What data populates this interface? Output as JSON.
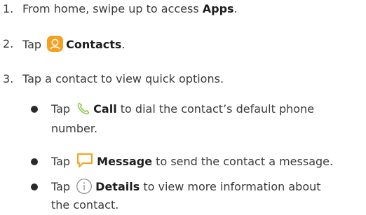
{
  "steps": [
    {
      "num": "1.",
      "before": "From home, swipe up to access ",
      "bold": "Apps",
      "after": "."
    },
    {
      "num": "2.",
      "before": "Tap ",
      "bold": "Contacts",
      "after": "."
    },
    {
      "num": "3.",
      "text": "Tap a contact to view quick options."
    }
  ],
  "bullets": [
    {
      "before": "Tap ",
      "bold": "Call",
      "after": " to dial the contact’s default phone",
      "line2": "number."
    },
    {
      "before": "Tap ",
      "bold": "Message",
      "after": " to send the contact a message."
    },
    {
      "before": "Tap ",
      "bold": "Details",
      "after": " to view more information about",
      "line2": "the contact."
    }
  ],
  "icons": {
    "contacts": "contacts-app-icon",
    "call": "phone-icon",
    "message": "message-icon",
    "details": "info-icon"
  },
  "colors": {
    "contacts_icon": "#f5a01e",
    "call_icon": "#8cc63f",
    "message_icon": "#f5a623",
    "details_icon": "#8a8a8a"
  }
}
